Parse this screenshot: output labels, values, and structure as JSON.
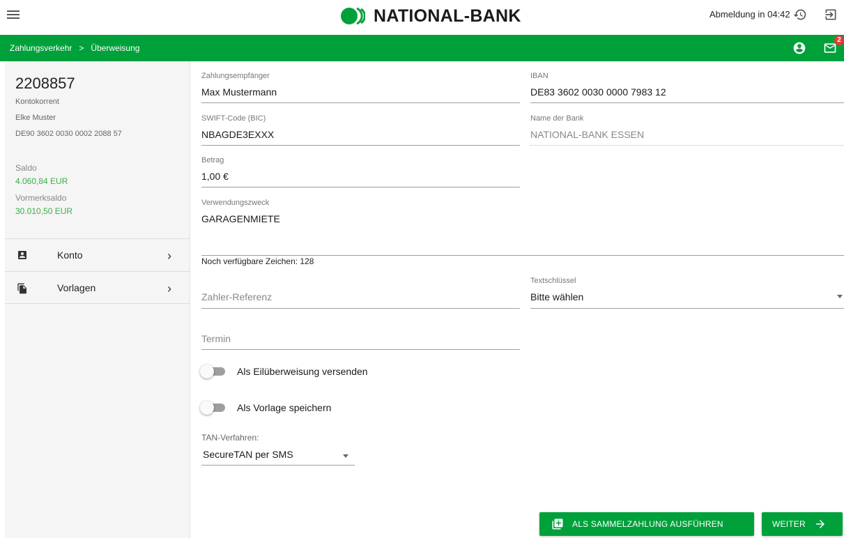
{
  "header": {
    "brand": "NATIONAL-BANK",
    "session_text": "Abmeldung in 04:42",
    "icons": [
      "menu-icon",
      "history-icon",
      "logout-icon"
    ]
  },
  "breadcrumb": {
    "items": [
      "Zahlungsverkehr",
      "Überweisung"
    ],
    "separator": ">"
  },
  "notifications": {
    "mail_count": "2"
  },
  "account": {
    "number": "2208857",
    "type": "Kontokorrent",
    "owner": "Elke Muster",
    "iban": "DE90 3602 0030 0002 2088 57",
    "saldo_label": "Saldo",
    "saldo_value": "4.060,84 EUR",
    "vormerksaldo_label": "Vormerksaldo",
    "vormerksaldo_value": "30.010,50 EUR"
  },
  "sidebar_nav": [
    {
      "label": "Konto",
      "icon": "contact-card-icon"
    },
    {
      "label": "Vorlagen",
      "icon": "file-copy-icon"
    }
  ],
  "form": {
    "recipient": {
      "label": "Zahlungsempfänger",
      "value": "Max Mustermann"
    },
    "iban": {
      "label": "IBAN",
      "value": "DE83 3602 0030 0000 7983 12"
    },
    "swift": {
      "label": "SWIFT-Code (BIC)",
      "value": "NBAGDE3EXXX"
    },
    "bank_name": {
      "label": "Name der Bank",
      "value": "NATIONAL-BANK ESSEN"
    },
    "amount": {
      "label": "Betrag",
      "value": "1,00 €"
    },
    "purpose": {
      "label": "Verwendungszweck",
      "value": "GARAGENMIETE"
    },
    "chars_left": "Noch verfügbare Zeichen: 128",
    "payer_reference": {
      "placeholder": "Zahler-Referenz"
    },
    "text_key": {
      "label": "Textschlüssel",
      "value": "Bitte wählen"
    },
    "date": {
      "placeholder": "Termin"
    },
    "express_toggle": {
      "label": "Als Eilüberweisung versenden",
      "on": false
    },
    "template_toggle": {
      "label": "Als Vorlage speichern",
      "on": false
    },
    "tan": {
      "label": "TAN-Verfahren:",
      "value": "SecureTAN per SMS"
    }
  },
  "actions": {
    "collect_label": "ALS SAMMELZAHLUNG AUSFÜHREN",
    "next_label": "WEITER"
  },
  "colors": {
    "brand_green": "#00a13b",
    "balance_green": "#3aae48",
    "badge_red": "#e53935"
  }
}
